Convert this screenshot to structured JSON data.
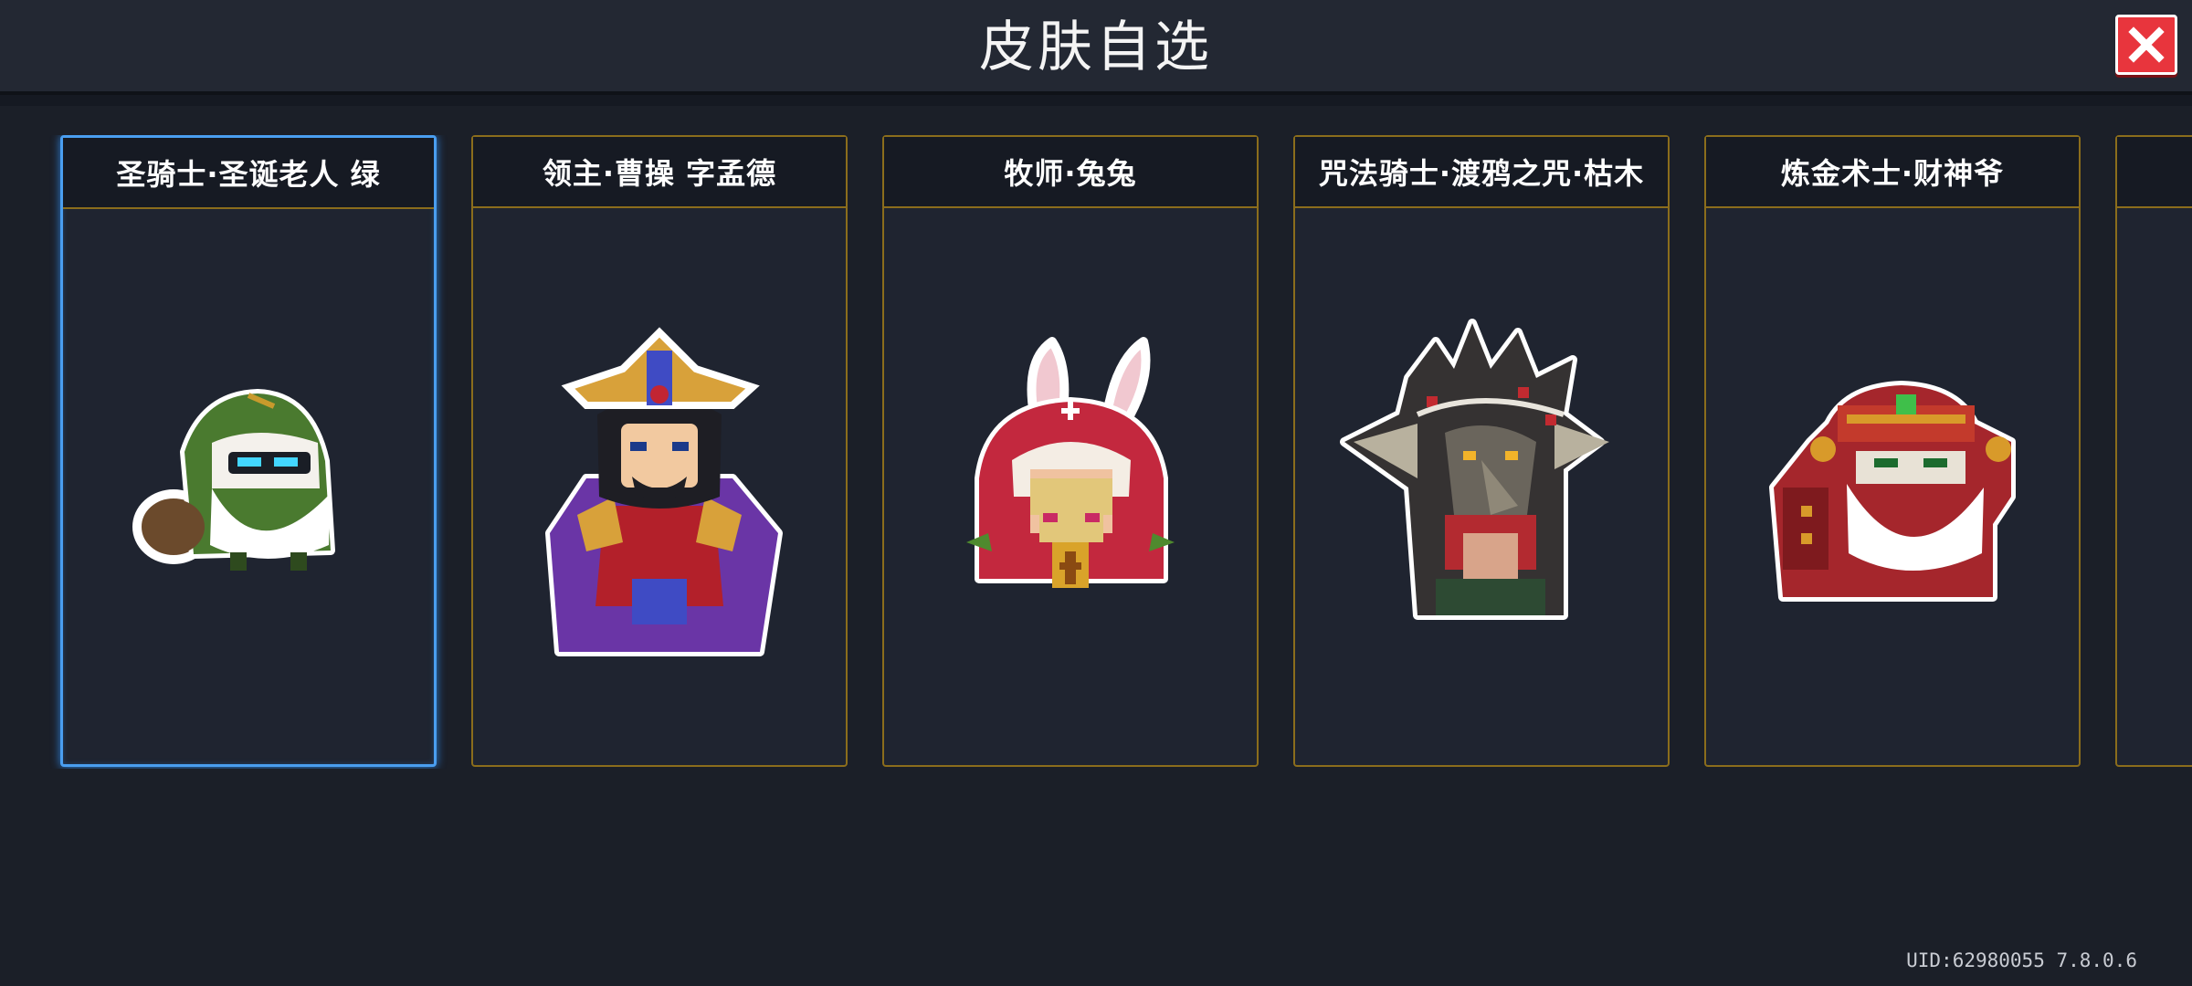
{
  "header": {
    "title": "皮肤自选"
  },
  "cards": [
    {
      "name": "圣骑士·圣诞老人 绿",
      "sprite": "paladin-santa-green-sprite",
      "selected": true
    },
    {
      "name": "领主·曹操 字孟德",
      "sprite": "lord-caocao-sprite",
      "selected": false
    },
    {
      "name": "牧师·兔兔",
      "sprite": "priest-bunny-sprite",
      "selected": false
    },
    {
      "name": "咒法骑士·渡鸦之咒·枯木",
      "sprite": "curse-knight-raven-sprite",
      "selected": false
    },
    {
      "name": "炼金术士·财神爷",
      "sprite": "alchemist-god-of-wealth-sprite",
      "selected": false
    }
  ],
  "footer": {
    "uid": "UID:62980055 7.8.0.6"
  },
  "colors": {
    "card_border": "#8b6d1c",
    "selected_border": "#4a9ef0",
    "close_button": "#e8353d"
  }
}
